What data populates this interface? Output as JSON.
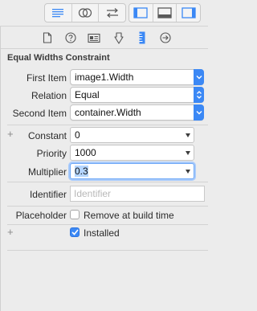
{
  "toolbar": {
    "icons": [
      "align-lines-icon",
      "overlapping-circles-icon",
      "swap-arrows-icon",
      "panel-left-icon",
      "panel-bottom-icon",
      "panel-right-icon"
    ],
    "accent": "#3b88f5"
  },
  "inspector_tabs": [
    "file-icon",
    "help-icon",
    "identity-card-icon",
    "attributes-icon",
    "size-ruler-icon",
    "connections-arrow-icon"
  ],
  "section_title": "Equal Widths Constraint",
  "first_item": {
    "label": "First Item",
    "value": "image1.Width"
  },
  "relation": {
    "label": "Relation",
    "value": "Equal"
  },
  "second_item": {
    "label": "Second Item",
    "value": "container.Width"
  },
  "constant": {
    "label": "Constant",
    "value": "0"
  },
  "priority": {
    "label": "Priority",
    "value": "1000"
  },
  "multiplier": {
    "label": "Multiplier",
    "value": "0.3"
  },
  "identifier": {
    "label": "Identifier",
    "placeholder": "Identifier",
    "value": ""
  },
  "placeholder": {
    "label": "Placeholder",
    "checkbox_label": "Remove at build time",
    "checked": false
  },
  "installed": {
    "checkbox_label": "Installed",
    "checked": true
  },
  "plus_symbol": "+"
}
